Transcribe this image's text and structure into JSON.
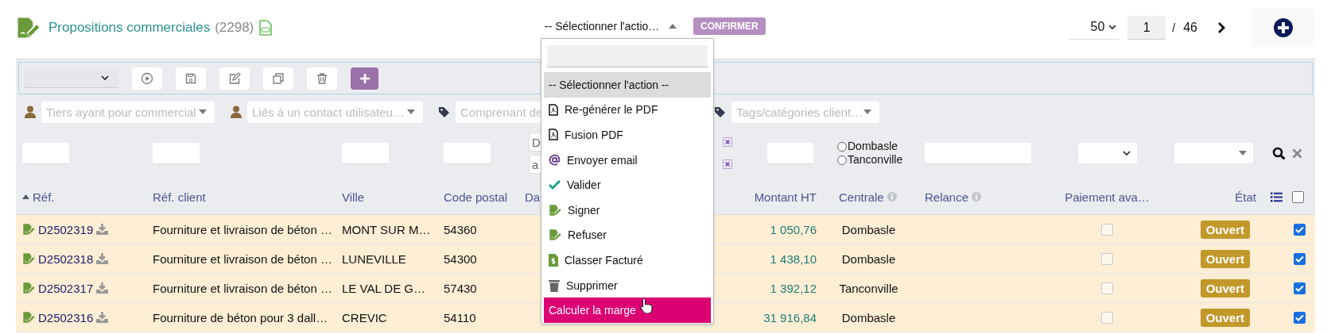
{
  "header": {
    "title": "Propositions commerciales",
    "count": "(2298)"
  },
  "action_select": {
    "value": "-- Sélectionner l'actio…",
    "expanded": true
  },
  "confirm_button": {
    "label": "CONFIRMER",
    "disabled": true
  },
  "pagination": {
    "page_size": "50",
    "page": "1",
    "separator": "/",
    "total_pages": "46"
  },
  "filters": [
    {
      "kind": "person",
      "placeholder": "Tiers ayant pour commercial"
    },
    {
      "kind": "person",
      "placeholder": "Liés à un contact utilisateu…"
    },
    {
      "kind": "tag",
      "placeholder": "Comprenant de"
    },
    {
      "kind": "tag",
      "placeholder": "Tags/catégories client…"
    }
  ],
  "date_filter": {
    "from_placeholder": "D",
    "to_placeholder": "a"
  },
  "centrale_filter": [
    {
      "label": "Dombasle",
      "selected": false
    },
    {
      "label": "Tanconville",
      "selected": false
    }
  ],
  "table": {
    "columns": [
      {
        "label": "Réf.",
        "sorted": true,
        "info": false
      },
      {
        "label": "Réf. client",
        "sorted": false,
        "info": false
      },
      {
        "label": "Ville",
        "sorted": false,
        "info": false
      },
      {
        "label": "Code postal",
        "sorted": false,
        "info": false
      },
      {
        "label": "Da",
        "sorted": false,
        "info": false
      },
      {
        "label": "Montant HT",
        "sorted": false,
        "info": false
      },
      {
        "label": "Centrale",
        "sorted": false,
        "info": true
      },
      {
        "label": "Relance",
        "sorted": false,
        "info": true
      },
      {
        "label": "Paiement ava…",
        "sorted": false,
        "info": false
      },
      {
        "label": "État",
        "sorted": false,
        "info": false
      }
    ],
    "all_selected": false,
    "rows": [
      {
        "ref": "D2502319",
        "client_ref": "Fourniture et livraison de béton …",
        "city": "MONT SUR M…",
        "postal_code": "54360",
        "amount": "1 050,76",
        "centrale": "Dombasle",
        "advance_payment": false,
        "state": "Ouvert",
        "selected": true
      },
      {
        "ref": "D2502318",
        "client_ref": "Fourniture et livraison de béton …",
        "city": "LUNEVILLE",
        "postal_code": "54300",
        "amount": "1 438,10",
        "centrale": "Dombasle",
        "advance_payment": false,
        "state": "Ouvert",
        "selected": true
      },
      {
        "ref": "D2502317",
        "client_ref": "Fourniture et livraison de béton …",
        "city": "LE VAL DE G…",
        "postal_code": "57430",
        "amount": "1 392,12",
        "centrale": "Tanconville",
        "advance_payment": false,
        "state": "Ouvert",
        "selected": true
      },
      {
        "ref": "D2502316",
        "client_ref": "Fourniture de béton pour 3 dall…",
        "city": "CREVIC",
        "postal_code": "54110",
        "amount": "31 916,84",
        "centrale": "Dombasle",
        "advance_payment": false,
        "state": "Ouvert",
        "selected": true
      }
    ]
  },
  "action_menu": {
    "items": [
      {
        "kind": "none",
        "label": "-- Sélectionner l'action --",
        "selected": true,
        "hovered": false
      },
      {
        "kind": "pdf",
        "label": "Re-générer le PDF",
        "selected": false,
        "hovered": false
      },
      {
        "kind": "pdf",
        "label": "Fusion PDF",
        "selected": false,
        "hovered": false
      },
      {
        "kind": "email",
        "label": "Envoyer email",
        "selected": false,
        "hovered": false
      },
      {
        "kind": "check",
        "label": "Valider",
        "selected": false,
        "hovered": false
      },
      {
        "kind": "sign",
        "label": "Signer",
        "selected": false,
        "hovered": false
      },
      {
        "kind": "sign",
        "label": "Refuser",
        "selected": false,
        "hovered": false
      },
      {
        "kind": "invoice",
        "label": "Classer Facturé",
        "selected": false,
        "hovered": false
      },
      {
        "kind": "trash",
        "label": "Supprimer",
        "selected": false,
        "hovered": false
      },
      {
        "kind": "none",
        "label": "Calculer la marge",
        "selected": false,
        "hovered": true
      }
    ]
  }
}
